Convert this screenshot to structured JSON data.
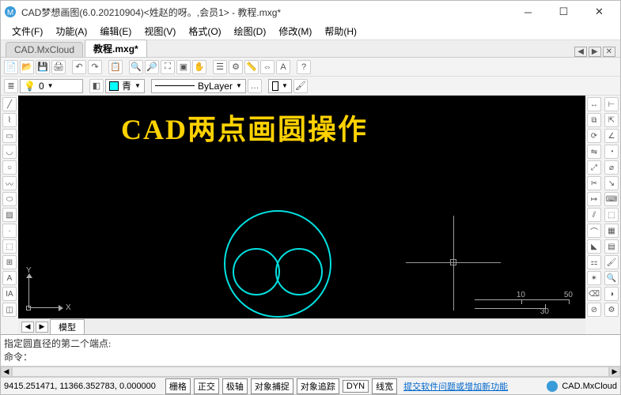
{
  "window": {
    "title": "CAD梦想画图(6.0.20210904)<姓赵的呀。,会员1> - 教程.mxg*"
  },
  "menu": {
    "file": "文件(F)",
    "func": "功能(A)",
    "edit": "编辑(E)",
    "view": "视图(V)",
    "format": "格式(O)",
    "draw": "绘图(D)",
    "modify": "修改(M)",
    "help": "帮助(H)"
  },
  "tabs": {
    "cloud": "CAD.MxCloud",
    "file": "教程.mxg*"
  },
  "toolbar2": {
    "layer": "0",
    "color": "青",
    "linetype": "ByLayer"
  },
  "canvas": {
    "title": "CAD两点画圆操作",
    "ucs_x": "X",
    "ucs_y": "Y",
    "scale": {
      "a": "10",
      "b": "50",
      "c": "30"
    }
  },
  "modeltabs": {
    "model": "模型"
  },
  "command": {
    "history": "指定圆直径的第二个端点:",
    "prompt": "命令："
  },
  "status": {
    "coords": "9415.251471, 11366.352783, 0.000000",
    "btns": {
      "grid": "栅格",
      "ortho": "正交",
      "polar": "极轴",
      "osnap": "对象捕捉",
      "otrack": "对象追踪",
      "dyn": "DYN",
      "lwt": "线宽"
    },
    "feedback": "提交软件问题或增加新功能",
    "brand": "CAD.MxCloud"
  }
}
